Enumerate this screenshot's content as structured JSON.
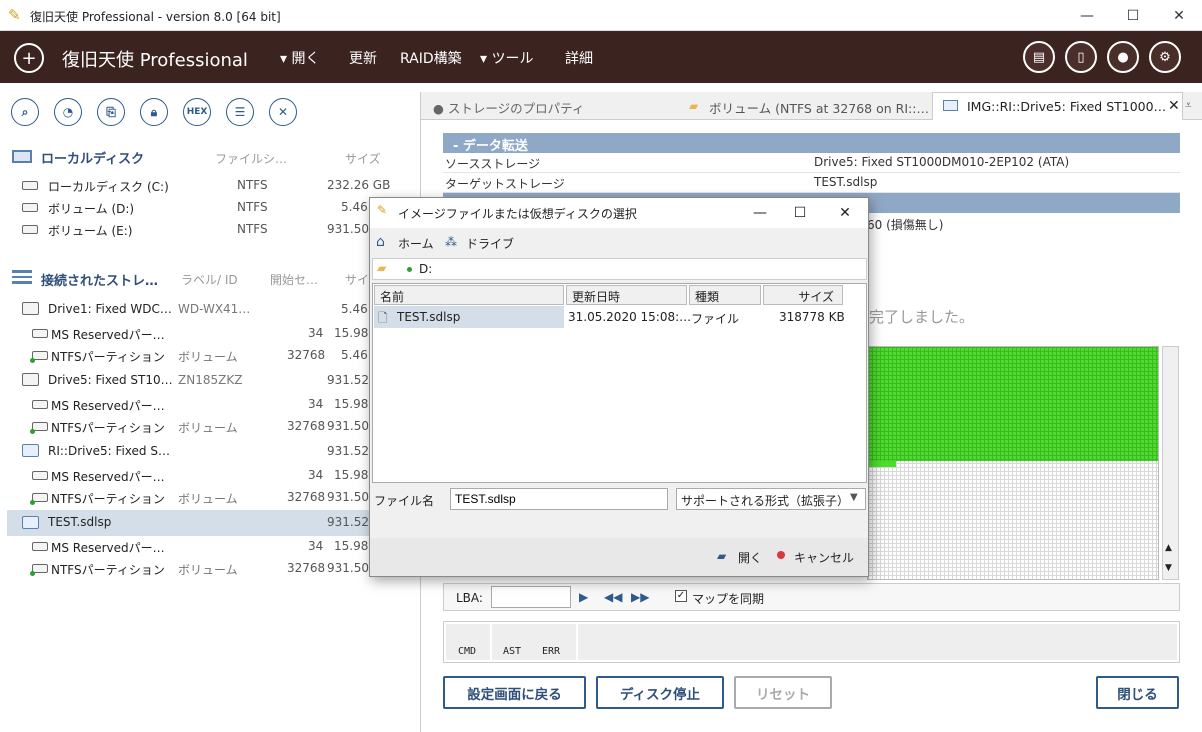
{
  "window": {
    "title": "復旧天使 Professional - version 8.0 [64 bit]",
    "minimize": "—",
    "maximize": "☐",
    "close": "✕"
  },
  "menubar": {
    "brand": "復旧天使 Professional",
    "items": [
      {
        "label": "▾ 開く"
      },
      {
        "label": "更新"
      },
      {
        "label": "RAID構築"
      },
      {
        "label": "▾ ツール"
      },
      {
        "label": "詳細"
      }
    ],
    "icons": [
      "chat-icon",
      "panel-icon",
      "user-icon",
      "settings-icon"
    ]
  },
  "toolbar": {
    "hex_label": "HEX",
    "close_symbol": "✕"
  },
  "local": {
    "header": "ローカルディスク",
    "col_fs": "ファイルシ…",
    "col_size": "サイズ",
    "items": [
      {
        "name": "ローカルディスク (C:)",
        "fs": "NTFS",
        "size": "232.26 GB"
      },
      {
        "name": "ボリューム (D:)",
        "fs": "NTFS",
        "size": "5.46"
      },
      {
        "name": "ボリューム (E:)",
        "fs": "NTFS",
        "size": "931.50"
      }
    ]
  },
  "connected": {
    "header": "接続されたストレ…",
    "col_label": "ラベル/ ID",
    "col_start": "開始セ…",
    "col_size": "サイ",
    "items": [
      {
        "name": "Drive1: Fixed WDC…",
        "label": "WD-WX41…",
        "start": "",
        "size": "5.46"
      },
      {
        "name": "MS Reservedパー…",
        "label": "",
        "start": "34",
        "size": "15.98"
      },
      {
        "name": "NTFSパーティション",
        "label": "ボリューム",
        "start": "32768",
        "size": "5.46"
      },
      {
        "name": "Drive5: Fixed ST10…",
        "label": "ZN185ZKZ",
        "start": "",
        "size": "931.52"
      },
      {
        "name": "MS Reservedパー…",
        "label": "",
        "start": "34",
        "size": "15.98"
      },
      {
        "name": "NTFSパーティション",
        "label": "ボリューム",
        "start": "32768",
        "size": "931.50"
      },
      {
        "name": "RI::Drive5: Fixed S…",
        "label": "",
        "start": "",
        "size": "931.52"
      },
      {
        "name": "MS Reservedパー…",
        "label": "",
        "start": "34",
        "size": "15.98"
      },
      {
        "name": "NTFSパーティション",
        "label": "ボリューム",
        "start": "32768",
        "size": "931.50"
      },
      {
        "name": "TEST.sdlsp",
        "label": "",
        "start": "",
        "size": "931.52"
      },
      {
        "name": "MS Reservedパー…",
        "label": "",
        "start": "34",
        "size": "15.98"
      },
      {
        "name": "NTFSパーティション",
        "label": "ボリューム",
        "start": "32768",
        "size": "931.50"
      }
    ]
  },
  "tabs": [
    {
      "label": "● ストレージのプロパティ"
    },
    {
      "label": "ボリューム (NTFS at 32768 on RI::…"
    },
    {
      "label": "IMG::RI::Drive5: Fixed ST1000…"
    }
  ],
  "transfer": {
    "header": "-  データ転送",
    "rows": [
      {
        "key": "ソースストレージ",
        "value": "Drive5: Fixed ST1000DM010-2EP102 (ATA)"
      },
      {
        "key": "ターゲットストレージ",
        "value": "TEST.sdlsp"
      }
    ],
    "partial_row": "60 (損傷無し)",
    "complete_msg": "完了しました。"
  },
  "lba": {
    "label": "LBA:",
    "value": "",
    "sync_label": "マップを同期",
    "sync_checked": true
  },
  "status": {
    "cmd": "CMD",
    "ast": "AST",
    "err": "ERR"
  },
  "buttons": {
    "back": "設定画面に戻る",
    "stop": "ディスク停止",
    "reset": "リセット",
    "close": "閉じる"
  },
  "dialog": {
    "title": "イメージファイルまたは仮想ディスクの選択",
    "home": "ホーム",
    "drive": "ドライブ",
    "path": "D:",
    "columns": {
      "name": "名前",
      "modified": "更新日時",
      "type": "種類",
      "size": "サイズ"
    },
    "files": [
      {
        "name": "TEST.sdlsp",
        "modified": "31.05.2020 15:08:…",
        "type": "ファイル",
        "size": "318778 KB"
      }
    ],
    "filename_label": "ファイル名",
    "filename_value": "TEST.sdlsp",
    "filter": "サポートされる形式（拡張子）",
    "open": "開く",
    "cancel": "キャンセル"
  }
}
